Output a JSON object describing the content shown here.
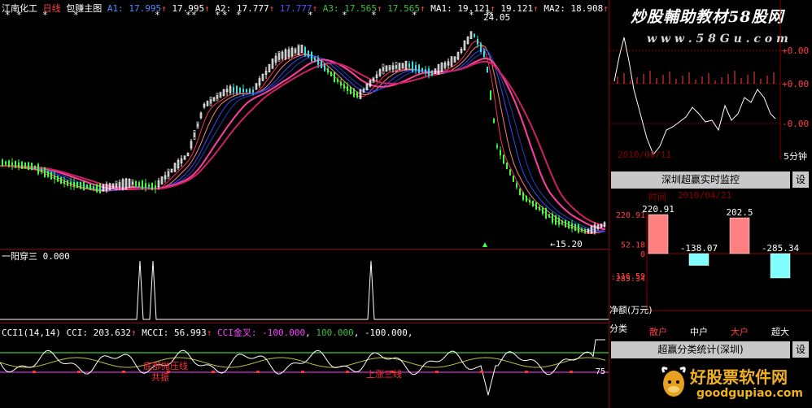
{
  "main_panel": {
    "stock_name": "江南化工",
    "period": "日线",
    "indicator": "包赚主图",
    "ind_values": [
      {
        "label": "A1:",
        "value": "17.995",
        "color": "#4f8dff"
      },
      {
        "label": "",
        "value": "17.995",
        "color": "#ffffff"
      },
      {
        "label": "A2:",
        "value": "17.777",
        "color": "#ffffff"
      },
      {
        "label": "",
        "value": "17.777",
        "color": "#5050ff"
      },
      {
        "label": "A3:",
        "value": "17.565",
        "color": "#3fbf3f"
      },
      {
        "label": "",
        "value": "17.565",
        "color": "#3fbf3f"
      },
      {
        "label": "MA1:",
        "value": "19.121",
        "color": "#ffffff"
      },
      {
        "label": "",
        "value": "19.121",
        "color": "#ffffff"
      },
      {
        "label": "MA2:",
        "value": "18.908",
        "color": "#ffffff"
      }
    ],
    "high_label": "24.05",
    "low_label": "15.20"
  },
  "sub_panel_1": {
    "title": "一阳穿三",
    "value": "0.000"
  },
  "sub_panel_2": {
    "title": "CCI1(14,14)",
    "cci_label": "CCI:",
    "cci_value": "203.632",
    "mcci_label": "MCCI:",
    "mcci_value": "56.993",
    "gold_label": "CCI金叉:",
    "gold_v1": "-100.000",
    "gold_v2": "100.000",
    "gold_v3": "-100.000,",
    "annotations": [
      "底部抛压线",
      "共振",
      "上涨三线"
    ],
    "right_scale": "75"
  },
  "right_top": {
    "watermark": "炒股輔助教材58股网",
    "watermark_url": "w w w . 5 8 G u . c o m",
    "date_label": "2010/06/11",
    "period_label": "5分钟",
    "scale": [
      "+0.00",
      "+0.00",
      "-0.00"
    ]
  },
  "right_mid": {
    "title": "深圳超赢实时监控",
    "settings": "设",
    "time_label": "时间",
    "date_value": "2010/04/21",
    "y_ticks": [
      "220.91",
      "52.18",
      "0",
      "-116.59",
      "-285.34"
    ],
    "bars": [
      {
        "label": "散户",
        "value": "220.91",
        "num": 220.91,
        "color": "#ff8080",
        "label_color": "#ff4040"
      },
      {
        "label": "中户",
        "value": "-138.07",
        "num": -138.07,
        "color": "#80ffff",
        "label_color": "#ffffff"
      },
      {
        "label": "大户",
        "value": "202.5",
        "num": 202.5,
        "color": "#ff8080",
        "label_color": "#ff4040"
      },
      {
        "label": "超大",
        "value": "-285.34",
        "num": -285.34,
        "color": "#80ffff",
        "label_color": "#ffffff"
      }
    ],
    "net_label": "净额(万元)",
    "category_label": "分类"
  },
  "right_bottom": {
    "title": "超赢分类统计(深圳)",
    "settings": "设",
    "brand": "好股票软件网",
    "brand_url": "goodgupiao.com"
  }
}
